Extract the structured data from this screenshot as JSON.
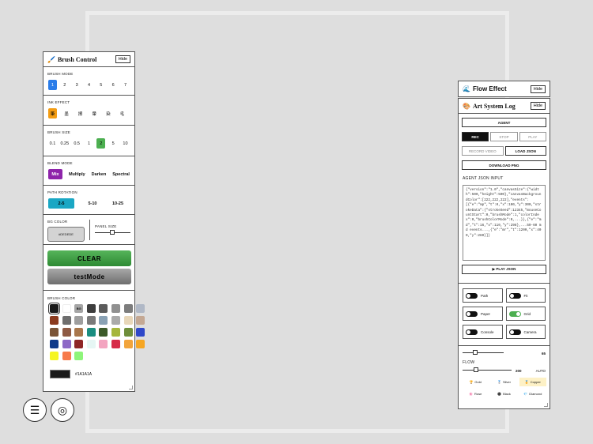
{
  "brush_panel": {
    "title": "Brush Control",
    "title_icon": "🖌️",
    "hide_label": "Hide",
    "brush_mode": {
      "label": "BRUSH MODE",
      "options": [
        "1",
        "2",
        "3",
        "4",
        "5",
        "6",
        "7"
      ],
      "selected": 0
    },
    "ink_effect": {
      "label": "INK EFFECT",
      "options": [
        "筆",
        "墨",
        "擦",
        "暈",
        "染",
        "毛"
      ],
      "selected": 0
    },
    "brush_size": {
      "label": "BRUSH SIZE",
      "options": [
        "0.1",
        "0.25",
        "0.5",
        "1",
        "2",
        "5",
        "10"
      ],
      "selected": 4
    },
    "blend_mode": {
      "label": "BLEND MODE",
      "options": [
        "Mix",
        "Multiply",
        "Darken",
        "Spectral"
      ],
      "selected": 0
    },
    "path_rotation": {
      "label": "PATH ROTATION",
      "options": [
        "2-5",
        "5-10",
        "10-25"
      ],
      "selected": 0
    },
    "bg_color": {
      "label": "BG COLOR",
      "value": "#DEDEDE"
    },
    "panel_size": {
      "label": "PANEL SIZE",
      "level": 0.48
    },
    "clear_label": "CLEAR",
    "test_mode_label": "testMode",
    "brush_color": {
      "label": "BRUSH COLOR",
      "bg_swatch_label": "BG",
      "current_hex": "#1A1A1A",
      "swatches": [
        "#1a1a1a",
        "#ffffff",
        "#a5a5a5",
        "#3d3d3d",
        "#5b5b5b",
        "#909090",
        "#7d7d7d",
        "#b0b8c6",
        "#8b3a1e",
        "#6e6e6e",
        "#9e9e9e",
        "#7a7a7a",
        "#8aa2b5",
        "#aaaaaa",
        "#e8d7b9",
        "#c4a893",
        "#7a5437",
        "#8e5a44",
        "#a8764b",
        "#1a8e80",
        "#3c5a2a",
        "#a6b63d",
        "#6f8e3a",
        "#2f48c9",
        "#0f3a8a",
        "#8e69c6",
        "#8e2626",
        "#e6f6f4",
        "#f3a5c0",
        "#d62b48",
        "#f2a43c",
        "#f6a623",
        "#f5f523",
        "#f77a4a",
        "#8ef57a"
      ],
      "selected": 0,
      "bg_index": 2
    }
  },
  "flow_panel": {
    "title": "Flow Effect",
    "title_icon": "🌊",
    "hide_label": "Hide"
  },
  "log_panel": {
    "title": "Art System Log",
    "title_icon": "🎨",
    "hide_label": "Hide",
    "agent_label": "AGENT",
    "rec_label": "REC",
    "stop_label": "STOP",
    "play_label": "PLAY",
    "record_video_label": "RECORD VIDEO",
    "load_json_label": "LOAD JSON",
    "download_png_label": "DOWNLOAD PNG",
    "json_input_label": "AGENT JSON INPUT",
    "json_text": "{\"version\":\"1.0\",\"canvasSize\":{\"width\":500,\"height\":500},\"canvasBackgroundColor\":[222,222,222],\"events\":[{\"e\":\"mp\",\"t\":0,\"x\":100,\"y\":300,\"strokeData\":{\"strokeSeed\":12345,\"mouseCountStart\":0,\"brushMode\":1,\"colorIndex\":0,\"brushColorMode\":0,...}},{\"e\":\"md\",\"t\":16,\"x\":110,\"y\":298},...50-60 md events...,{\"e\":\"mr\",\"t\":1200,\"x\":400,\"y\":280}]}",
    "play_json_label": "▶ PLAY JSON",
    "toggles": [
      {
        "label": "Path",
        "on": false
      },
      {
        "label": "Fit",
        "on": false
      },
      {
        "label": "Paper",
        "on": false
      },
      {
        "label": "Grid",
        "on": true
      },
      {
        "label": "Console",
        "on": false
      },
      {
        "label": "Camera",
        "on": false
      }
    ],
    "slider1": {
      "value": "65",
      "level": 0.3
    },
    "flow_label": "FLOW",
    "slider2": {
      "value": "200",
      "level": 0.28
    },
    "auto_label": "AUTO",
    "materials": [
      {
        "label": "Gold",
        "icon": "🏆",
        "selected": false
      },
      {
        "label": "Silver",
        "icon": "🥈",
        "selected": false
      },
      {
        "label": "Copper",
        "icon": "🏅",
        "selected": true
      },
      {
        "label": "Rose",
        "icon": "🌸",
        "selected": false
      },
      {
        "label": "Black",
        "icon": "⚫",
        "selected": false
      },
      {
        "label": "Diamond",
        "icon": "💎",
        "selected": false
      }
    ]
  },
  "fab": {
    "menu_icon": "☰",
    "target_icon": "◎"
  }
}
